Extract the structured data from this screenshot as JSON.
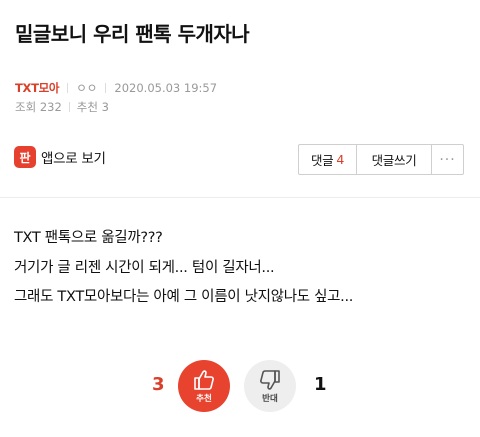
{
  "post": {
    "title": "밑글보니 우리 팬톡 두개자나",
    "board": "TXT모아",
    "author": "ㅇㅇ",
    "date": "2020.05.03 19:57",
    "views": "조회 232",
    "recommends": "추천 3"
  },
  "app_link": {
    "icon_text": "판",
    "label": "앱으로 보기"
  },
  "actions": {
    "comments_label": "댓글",
    "comments_count": "4",
    "write_label": "댓글쓰기",
    "more_label": "···"
  },
  "content": {
    "lines": [
      "TXT 팬톡으로 옮길까???",
      "거기가 글 리젠 시간이 되게... 텀이 길자너...",
      "그래도 TXT모아보다는 아예 그 이름이 낫지않나도 싶고..."
    ]
  },
  "vote": {
    "up_count": "3",
    "up_label": "추천",
    "down_count": "1",
    "down_label": "반대"
  },
  "colors": {
    "accent": "#d8402a",
    "up_button": "#e8432f",
    "down_button": "#eeeeee"
  },
  "icons": {
    "thumbs_up": "thumbs-up-icon",
    "thumbs_down": "thumbs-down-icon"
  }
}
